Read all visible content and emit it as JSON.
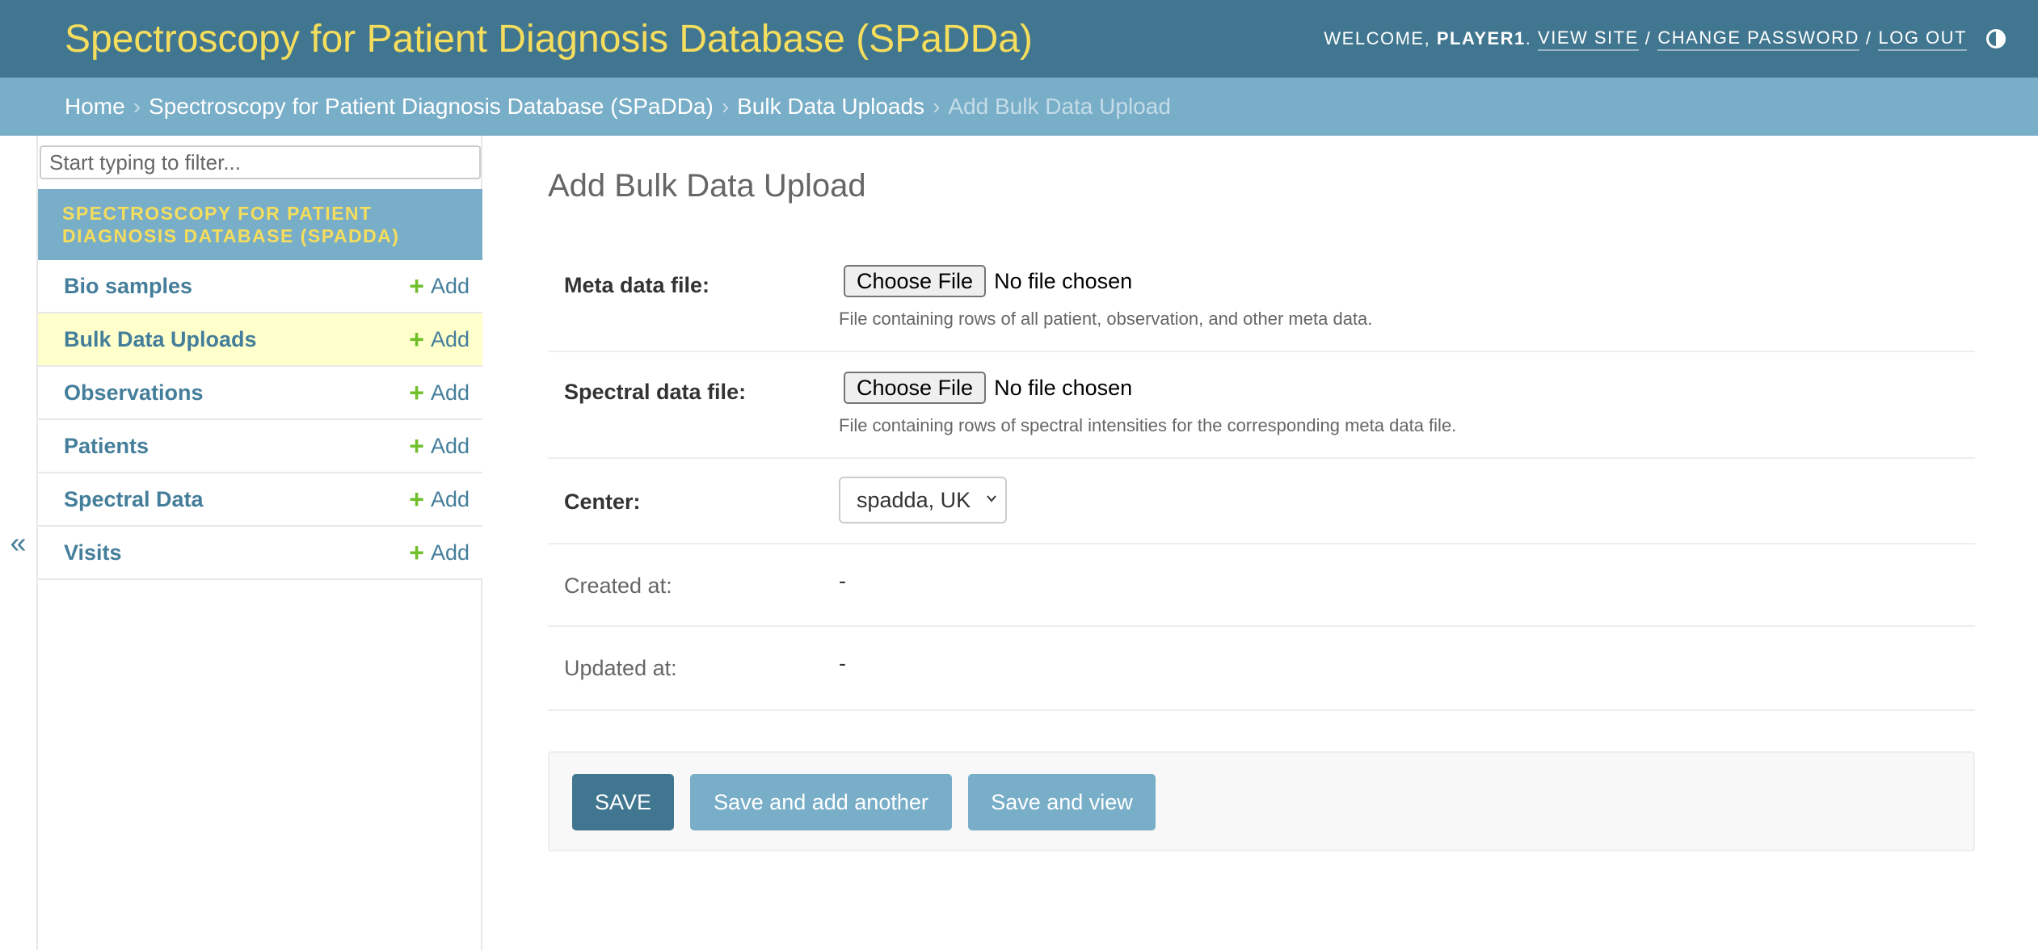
{
  "header": {
    "site_name": "Spectroscopy for Patient Diagnosis Database (SPaDDa)",
    "welcome_prefix": "Welcome,",
    "username": "player1",
    "view_site": "View site",
    "change_password": "Change password",
    "log_out": "Log out",
    "separator": "/",
    "theme_icon": "contrast-half-circle-icon"
  },
  "breadcrumbs": {
    "separator": "›",
    "items": [
      "Home",
      "Spectroscopy for Patient Diagnosis Database (SPaDDa)",
      "Bulk Data Uploads"
    ],
    "current": "Add Bulk Data Upload"
  },
  "sidebar": {
    "filter_placeholder": "Start typing to filter...",
    "app_caption": "Spectroscopy for Patient Diagnosis Database (SPaDDa)",
    "add_label": "Add",
    "add_icon": "+",
    "models": [
      {
        "label": "Bio samples",
        "current": false
      },
      {
        "label": "Bulk Data Uploads",
        "current": true
      },
      {
        "label": "Observations",
        "current": false
      },
      {
        "label": "Patients",
        "current": false
      },
      {
        "label": "Spectral Data",
        "current": false
      },
      {
        "label": "Visits",
        "current": false
      }
    ],
    "toggle_label": "«"
  },
  "form": {
    "title": "Add Bulk Data Upload",
    "meta_file": {
      "label": "Meta data file:",
      "button": "Choose File",
      "status": "No file chosen",
      "help": "File containing rows of all patient, observation, and other meta data."
    },
    "spectral_file": {
      "label": "Spectral data file:",
      "button": "Choose File",
      "status": "No file chosen",
      "help": "File containing rows of spectral intensities for the corresponding meta data file."
    },
    "center": {
      "label": "Center:",
      "selected": "spadda, UK"
    },
    "created_at": {
      "label": "Created at:",
      "value": "-"
    },
    "updated_at": {
      "label": "Updated at:",
      "value": "-"
    }
  },
  "buttons": {
    "save": "Save",
    "save_add_another": "Save and add another",
    "save_view": "Save and view"
  },
  "colors": {
    "header_bg": "#417690",
    "breadcrumb_bg": "#79aec8",
    "brand_yellow": "#f5dd5d",
    "link": "#447e9b",
    "add_green": "#70bf2b",
    "selected_row": "#ffffcc"
  }
}
